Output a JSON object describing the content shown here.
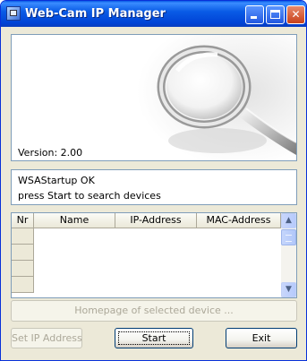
{
  "window": {
    "title": "Web-Cam IP Manager",
    "controls": {
      "minimize_icon": "minimize-icon",
      "maximize_icon": "maximize-icon",
      "close_icon": "close-icon"
    },
    "close_glyph": "✕"
  },
  "banner": {
    "image_icon": "magnifying-glass-icon",
    "version_text": "Version: 2.00"
  },
  "status": {
    "lines": [
      "WSAStartup OK",
      "press Start to search devices"
    ]
  },
  "device_table": {
    "columns": [
      "Nr",
      "Name",
      "IP-Address",
      "MAC-Address"
    ],
    "rows": [],
    "scroll_up_glyph": "▲",
    "scroll_down_glyph": "▼"
  },
  "buttons": {
    "homepage_label": "Homepage of selected device ...",
    "set_ip_label": "Set IP Address",
    "start_label": "Start",
    "exit_label": "Exit"
  },
  "colors": {
    "titlebar": "#0a5ce6",
    "window_bg": "#ece9d8",
    "border": "#7f9db9"
  }
}
